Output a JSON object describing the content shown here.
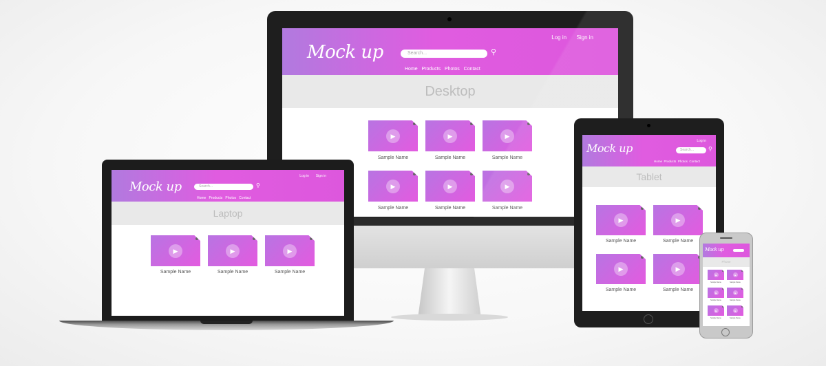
{
  "brand": {
    "logo": "Mock up",
    "accent": "#dd57dd",
    "accent_start": "#b17adf",
    "hero_bg": "#e9e9e9"
  },
  "auth": {
    "login": "Log in",
    "signup": "Sign in"
  },
  "search": {
    "placeholder": "Search..."
  },
  "nav": [
    "Home",
    "Products",
    "Photos",
    "Contact"
  ],
  "desktop": {
    "title": "Desktop",
    "cards": [
      "Sample Name",
      "Sample Name",
      "Sample Name",
      "Sample Name",
      "Sample Name",
      "Sample Name"
    ]
  },
  "laptop": {
    "title": "Laptop",
    "cards": [
      "Sample Name",
      "Sample Name",
      "Sample Name"
    ]
  },
  "tablet": {
    "title": "Tablet",
    "auth_login": "Log in",
    "cards": [
      "Sample Name",
      "Sample Name",
      "Sample Name",
      "Sample Name"
    ]
  },
  "phone": {
    "title": "Phone",
    "cards": [
      "Sample Name",
      "Sample Name",
      "Sample Name",
      "Sample Name",
      "Sample Name",
      "Sample Name"
    ]
  },
  "icons": {
    "search": "search-icon",
    "play": "play-icon"
  }
}
